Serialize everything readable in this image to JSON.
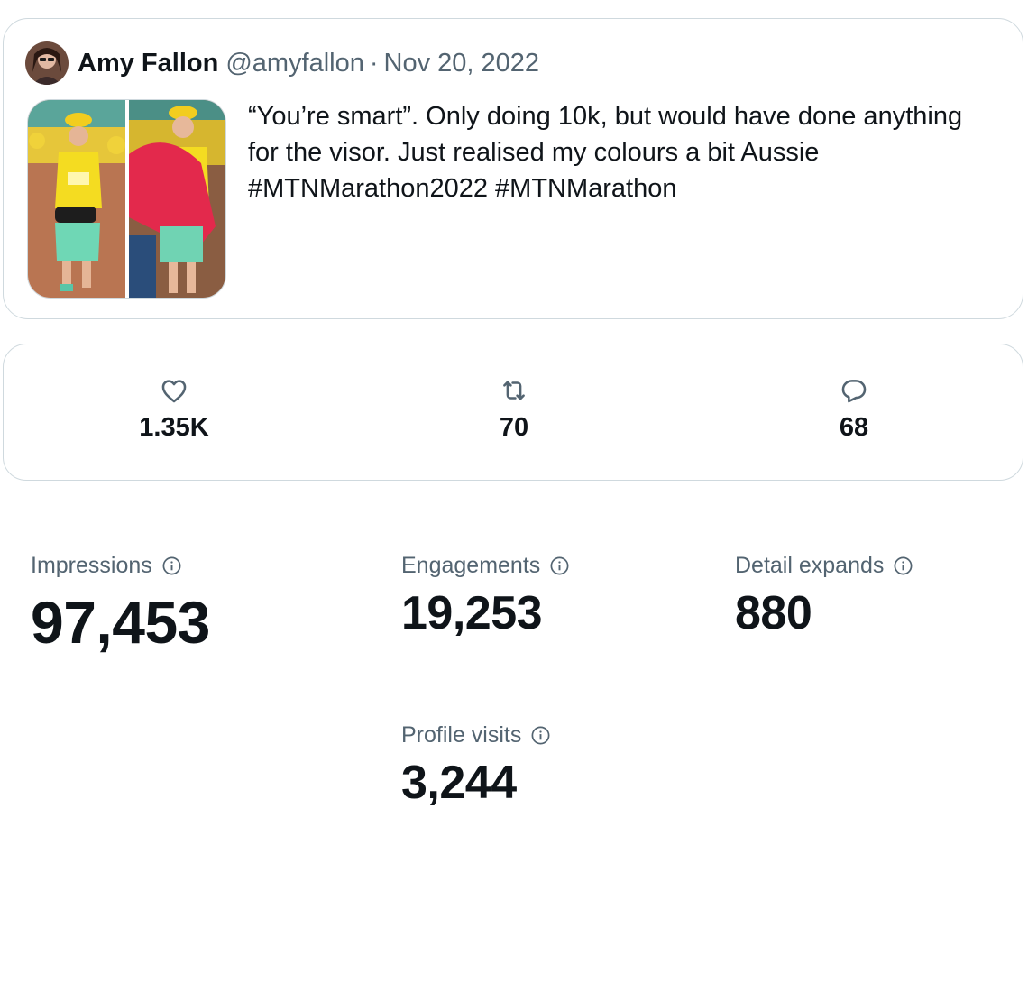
{
  "tweet": {
    "author_name": "Amy Fallon",
    "author_handle": "@amyfallon",
    "separator": "·",
    "date": "Nov 20, 2022",
    "text": "“You’re smart”. Only doing 10k, but would have done anything for the visor. Just realised my colours a bit Aussie #MTNMarathon2022 #MTNMarathon",
    "media_count": 2
  },
  "engagement": {
    "likes": {
      "icon": "heart-icon",
      "value": "1.35K"
    },
    "retweets": {
      "icon": "retweet-icon",
      "value": "70"
    },
    "replies": {
      "icon": "reply-icon",
      "value": "68"
    }
  },
  "metrics": {
    "impressions": {
      "label": "Impressions",
      "value": "97,453"
    },
    "engagements": {
      "label": "Engagements",
      "value": "19,253"
    },
    "detail_expands": {
      "label": "Detail expands",
      "value": "880"
    },
    "profile_visits": {
      "label": "Profile visits",
      "value": "3,244"
    }
  },
  "colors": {
    "text_primary": "#0f1419",
    "text_secondary": "#536471",
    "border": "#cfd9de"
  }
}
